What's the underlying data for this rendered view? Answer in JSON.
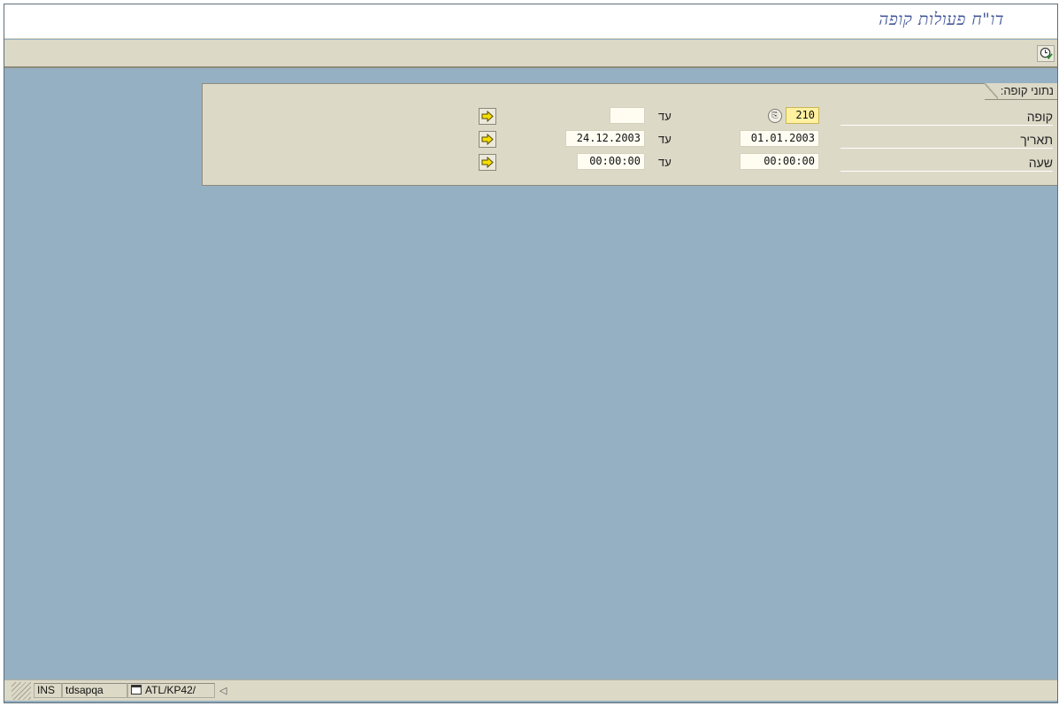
{
  "window": {
    "title": "דו\"ח פעולות קופה"
  },
  "toolbar": {
    "execute_icon": "execute-clock-icon"
  },
  "selection": {
    "group_title": "נתוני קופה:",
    "to_label": "עד",
    "rows": [
      {
        "label": "קופה",
        "from": "210",
        "to": ""
      },
      {
        "label": "תאריך",
        "from": "01.01.2003",
        "to": "24.12.2003"
      },
      {
        "label": "שעה",
        "from": "00:00:00",
        "to": "00:00:00"
      }
    ],
    "multiple_selection_icon": "yellow-arrow-icon"
  },
  "statusbar": {
    "mode": "INS",
    "system": "tdsapqa",
    "transaction": "ATL/KP42/"
  },
  "colors": {
    "background": "#95b0c3",
    "panel": "#dcd9c7",
    "title": "#44589a",
    "active_field": "#fff1a0"
  }
}
